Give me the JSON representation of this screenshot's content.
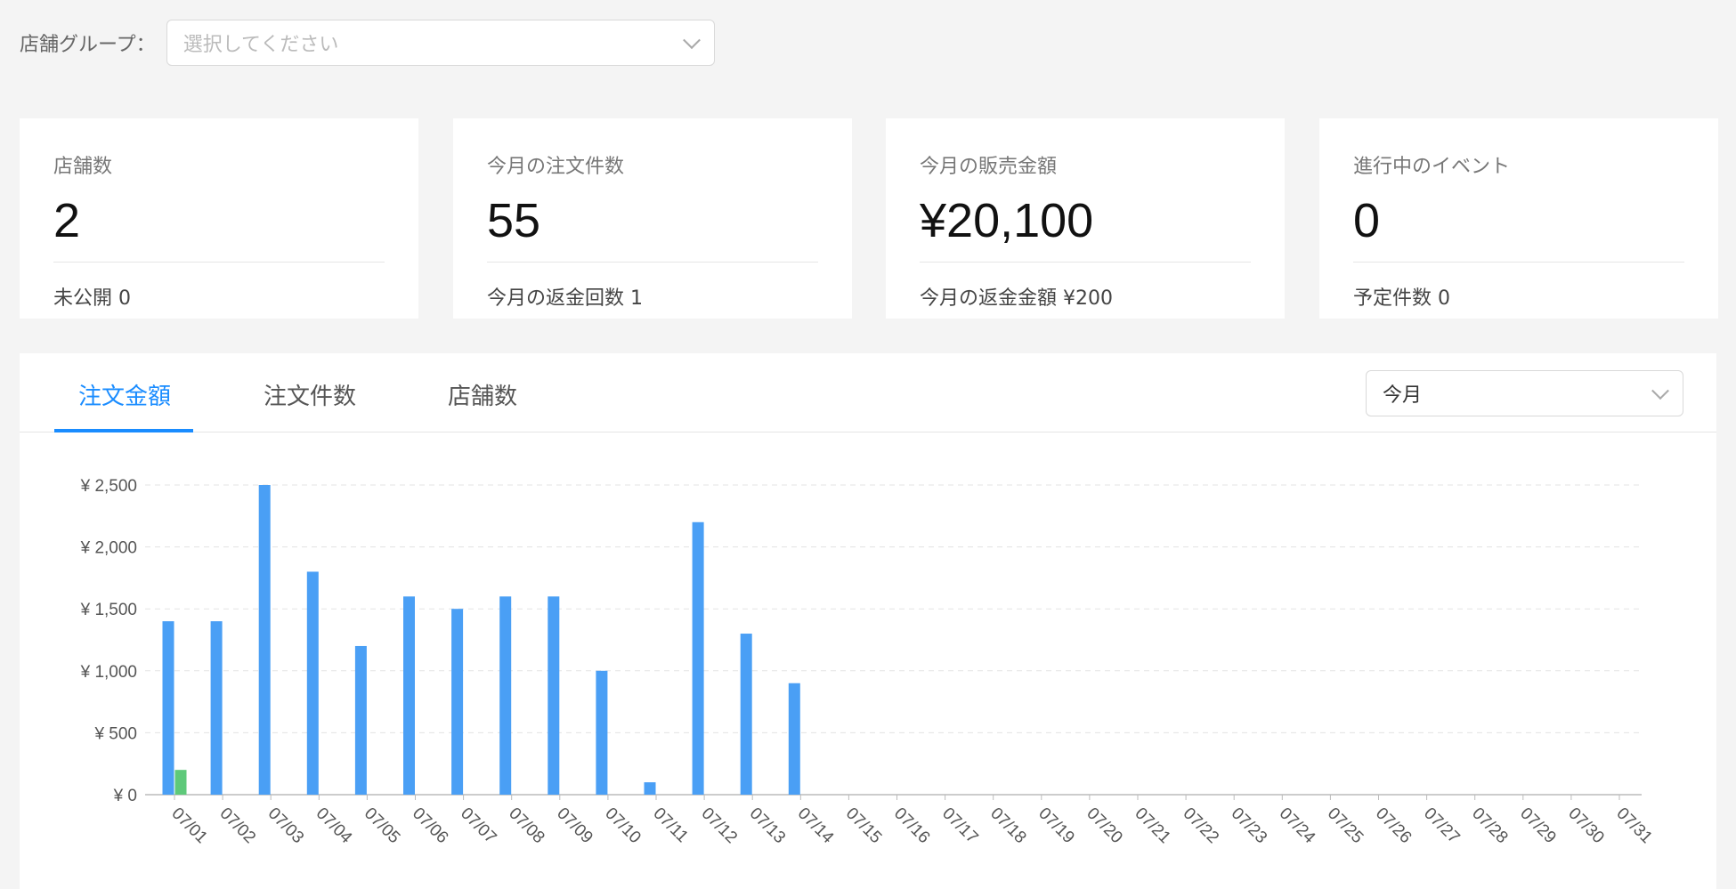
{
  "filter": {
    "label": "店舗グループ：",
    "placeholder": "選択してください"
  },
  "cards": [
    {
      "title": "店舗数",
      "value": "2",
      "sub": "未公開 0"
    },
    {
      "title": "今月の注文件数",
      "value": "55",
      "sub": "今月の返金回数 1"
    },
    {
      "title": "今月の販売金額",
      "value": "¥20,100",
      "sub": "今月の返金金額 ¥200"
    },
    {
      "title": "進行中のイベント",
      "value": "0",
      "sub": "予定件数 0"
    }
  ],
  "tabs": [
    {
      "label": "注文金額",
      "active": true
    },
    {
      "label": "注文件数",
      "active": false
    },
    {
      "label": "店舗数",
      "active": false
    }
  ],
  "period": {
    "selected": "今月"
  },
  "colors": {
    "accent": "#1a8cff",
    "bar_primary": "#4a9ff5",
    "bar_secondary": "#5ec97a"
  },
  "chart_data": {
    "type": "bar",
    "categories": [
      "07/01",
      "07/02",
      "07/03",
      "07/04",
      "07/05",
      "07/06",
      "07/07",
      "07/08",
      "07/09",
      "07/10",
      "07/11",
      "07/12",
      "07/13",
      "07/14",
      "07/15",
      "07/16",
      "07/17",
      "07/18",
      "07/19",
      "07/20",
      "07/21",
      "07/22",
      "07/23",
      "07/24",
      "07/25",
      "07/26",
      "07/27",
      "07/28",
      "07/29",
      "07/30",
      "07/31"
    ],
    "series": [
      {
        "values": [
          1400,
          1400,
          2500,
          1800,
          1200,
          1600,
          1500,
          1600,
          1600,
          1000,
          100,
          2200,
          1300,
          900,
          0,
          0,
          0,
          0,
          0,
          0,
          0,
          0,
          0,
          0,
          0,
          0,
          0,
          0,
          0,
          0,
          0
        ]
      },
      {
        "values": [
          200,
          0,
          0,
          0,
          0,
          0,
          0,
          0,
          0,
          0,
          0,
          0,
          0,
          0,
          0,
          0,
          0,
          0,
          0,
          0,
          0,
          0,
          0,
          0,
          0,
          0,
          0,
          0,
          0,
          0,
          0
        ]
      }
    ],
    "yticks": [
      "¥ 0",
      "¥ 500",
      "¥ 1,000",
      "¥ 1,500",
      "¥ 2,000",
      "¥ 2,500"
    ],
    "ylim": [
      0,
      2500
    ],
    "grid": true,
    "title": "",
    "xlabel": "",
    "ylabel": ""
  }
}
